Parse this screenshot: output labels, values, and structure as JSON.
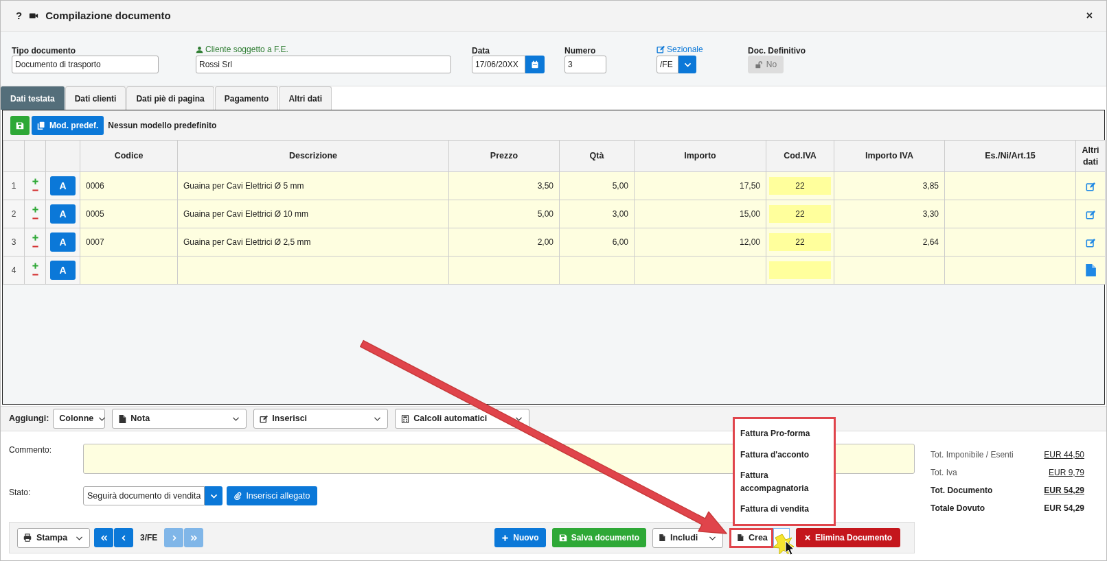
{
  "window": {
    "help": "?",
    "title": "Compilazione documento",
    "close": "×"
  },
  "form": {
    "tipo_documento": {
      "label": "Tipo documento",
      "value": "Documento di trasporto"
    },
    "cliente": {
      "label": "Cliente soggetto a F.E.",
      "value": "Rossi Srl"
    },
    "data": {
      "label": "Data",
      "value": "17/06/20XX"
    },
    "numero": {
      "label": "Numero",
      "value": "3"
    },
    "sezionale": {
      "label": "Sezionale",
      "value": "/FE"
    },
    "doc_definitivo": {
      "label": "Doc. Definitivo",
      "value": "No",
      "disabled": true
    }
  },
  "tabs": [
    {
      "label": "Dati testata",
      "selected": true
    },
    {
      "label": "Dati clienti",
      "selected": false
    },
    {
      "label": "Dati piè di pagina",
      "selected": false
    },
    {
      "label": "Pagamento",
      "selected": false
    },
    {
      "label": "Altri dati",
      "selected": false
    }
  ],
  "toolbar": {
    "button": "Mod. predef.",
    "text": "Nessun modello predefinito"
  },
  "table": {
    "columns": [
      "Codice",
      "Descrizione",
      "Prezzo",
      "Qtà",
      "Importo",
      "Cod.IVA",
      "Importo IVA",
      "Es./Ni/Art.15",
      "Altri dati"
    ],
    "rows": [
      {
        "number": "1",
        "kind": "item",
        "action": "A",
        "codice": "0006",
        "descrizione": "Guaina per Cavi Elettrici Ø 5 mm",
        "prezzo": "3,50",
        "qta": "5,00",
        "importo": "17,50",
        "cod_iva": "22",
        "importo_iva": "3,85"
      },
      {
        "number": "2",
        "kind": "item",
        "action": "A",
        "codice": "0005",
        "descrizione": "Guaina per Cavi Elettrici Ø 10 mm",
        "prezzo": "5,00",
        "qta": "3,00",
        "importo": "15,00",
        "cod_iva": "22",
        "importo_iva": "3,30"
      },
      {
        "number": "3",
        "kind": "item",
        "action": "A",
        "codice": "0007",
        "descrizione": "Guaina per Cavi Elettrici Ø 2,5 mm",
        "prezzo": "2,00",
        "qta": "6,00",
        "importo": "12,00",
        "cod_iva": "22",
        "importo_iva": "2,64"
      },
      {
        "number": "4",
        "kind": "new",
        "action": "A"
      }
    ]
  },
  "add_bar": {
    "label": "Aggiungi:",
    "dropdowns": [
      {
        "label": "Colonne",
        "kind": "columns"
      },
      {
        "label": "Nota",
        "kind": "note"
      },
      {
        "label": "Inserisci",
        "kind": "insert"
      },
      {
        "label": "Calcoli automatici",
        "kind": "calculations"
      }
    ]
  },
  "comment": {
    "label": "Commento:"
  },
  "stato": {
    "label": "Stato:",
    "value": "Seguirà documento di vendita",
    "attach_button": "Inserisci allegato"
  },
  "totals": [
    {
      "label": "Tot. Imponibile / Esenti",
      "value": "EUR 44,50",
      "bold": false,
      "linked": true
    },
    {
      "label": "Tot. Iva",
      "value": "EUR 9,79",
      "bold": false,
      "linked": true
    },
    {
      "label": "Tot. Documento",
      "value": "EUR 54,29",
      "bold": true,
      "linked": true
    },
    {
      "label": "Totale Dovuto",
      "value": "EUR 54,29",
      "bold": true,
      "linked": false
    }
  ],
  "bottom_bar": {
    "print": "Stampa",
    "nav": [
      {
        "kind": "first",
        "disabled": false
      },
      {
        "kind": "prev",
        "disabled": false
      },
      {
        "kind": "next",
        "disabled": true
      },
      {
        "kind": "last",
        "disabled": true
      }
    ],
    "position": "3/FE",
    "new": "Nuovo",
    "save": "Salva documento",
    "include": "Includi",
    "create": "Crea",
    "delete": "Elimina Documento"
  },
  "create_menu": {
    "expanded": true,
    "items": [
      "Fattura Pro-forma",
      "Fattura d'acconto",
      "Fattura accompagnatoria",
      "Fattura di vendita"
    ]
  }
}
